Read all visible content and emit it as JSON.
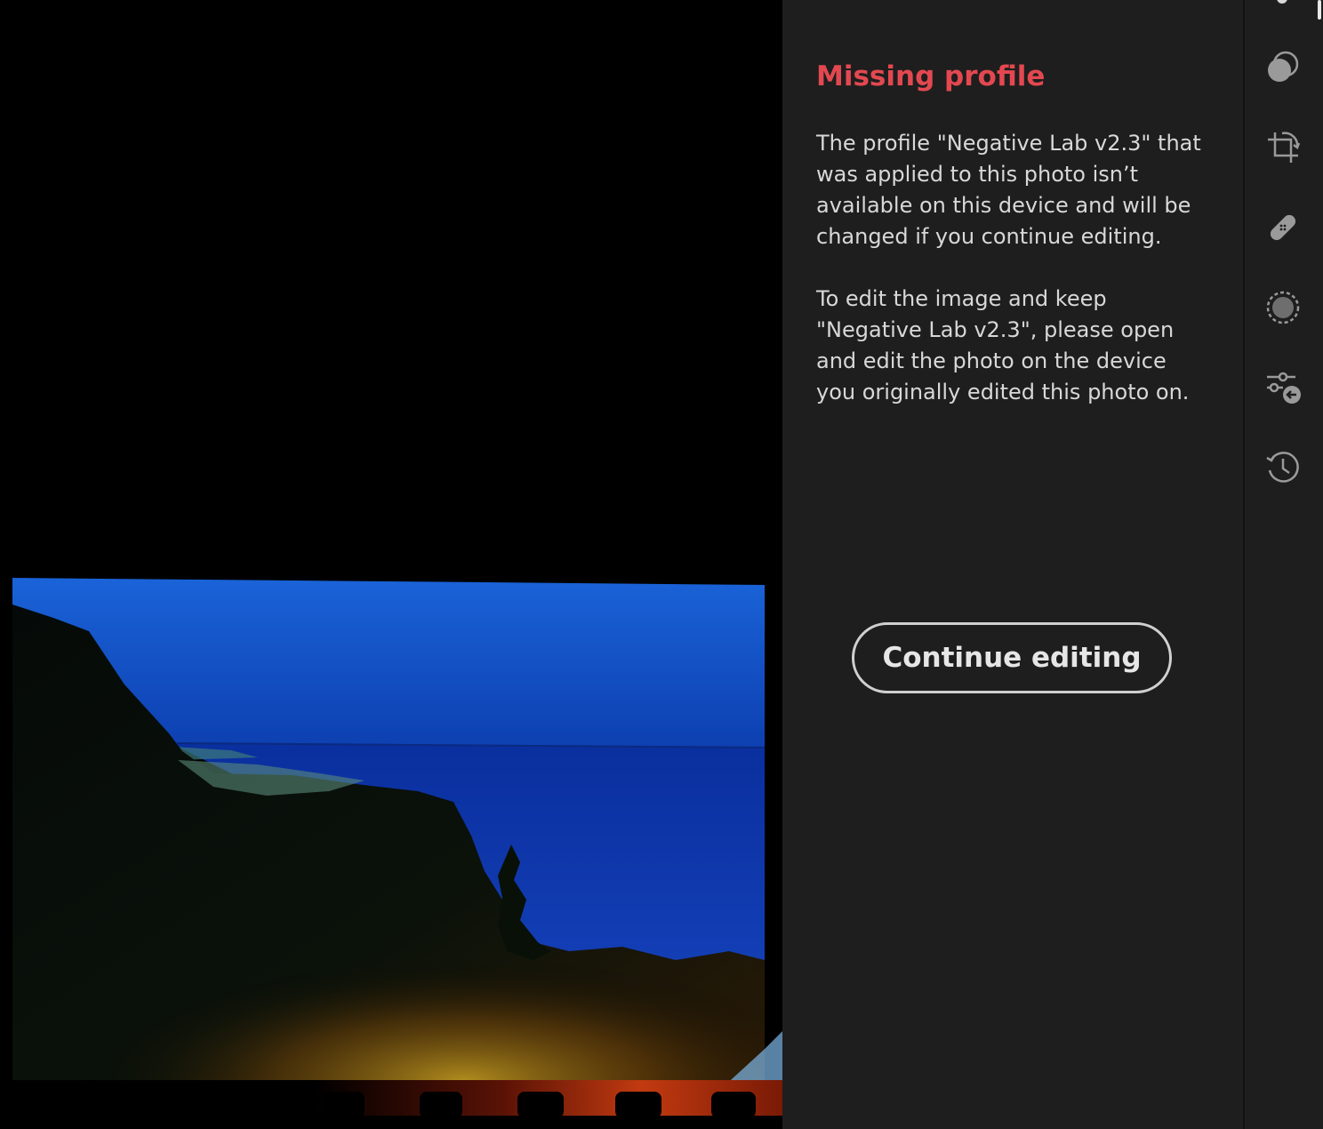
{
  "dialog": {
    "title": "Missing profile",
    "paragraph1": "The profile \"Negative Lab v2.3\" that was applied to this photo isn’t available on this device and will be changed if you continue editing.",
    "paragraph2": "To edit the image and keep \"Negative Lab v2.3\", please open and edit the photo on the device you originally edited this photo on.",
    "continue_label": "Continue editing",
    "title_color": "#e34850"
  },
  "toolbar": {
    "tools": [
      {
        "icon": "presets-icon"
      },
      {
        "icon": "crop-rotate-icon"
      },
      {
        "icon": "healing-bandage-icon"
      },
      {
        "icon": "masking-icon"
      },
      {
        "icon": "versions-compare-icon"
      },
      {
        "icon": "history-icon"
      }
    ]
  }
}
